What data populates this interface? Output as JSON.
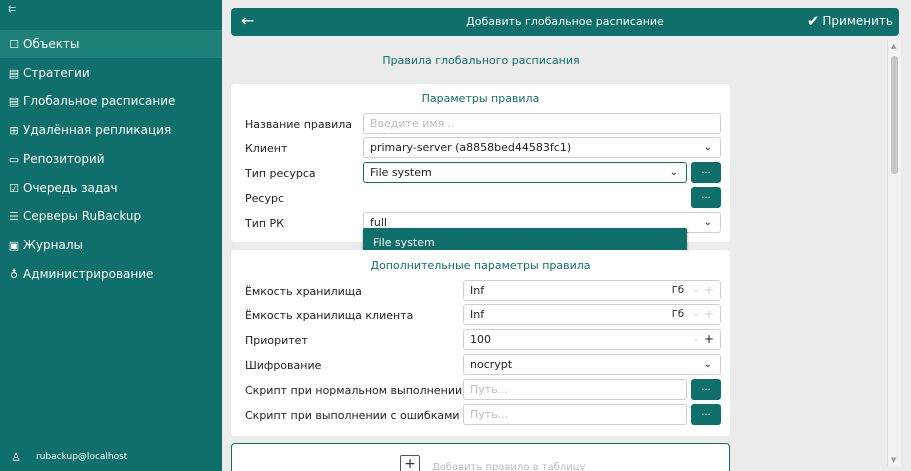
{
  "sidebar": {
    "collapse_icon": "⇇",
    "items": [
      {
        "icon": "☐",
        "label": "Объекты"
      },
      {
        "icon": "▤",
        "label": "Стратегии"
      },
      {
        "icon": "▤",
        "label": "Глобальное расписание"
      },
      {
        "icon": "⊞",
        "label": "Удалённая репликация"
      },
      {
        "icon": "▭",
        "label": "Репозиторий"
      },
      {
        "icon": "☑",
        "label": "Очередь задач"
      },
      {
        "icon": "☰",
        "label": "Серверы RuBackup"
      },
      {
        "icon": "▣",
        "label": "Журналы"
      },
      {
        "icon": "♁",
        "label": "Администрирование"
      }
    ],
    "user": {
      "icon": "♙",
      "label": "rubackup@localhost"
    }
  },
  "header": {
    "back_icon": "←",
    "title": "Добавить глобальное расписание",
    "apply_icon": "✔",
    "apply_label": "Применить"
  },
  "main": {
    "section_title": "Правила глобального расписания",
    "params": {
      "title": "Параметры правила",
      "rule_name_label": "Название правила",
      "rule_name_placeholder": "Введите имя ..",
      "client_label": "Клиент",
      "client_value": "primary-server (a8858bed44583fc1)",
      "resource_type_label": "Тип ресурса",
      "resource_type_value": "File system",
      "resource_label": "Ресурс",
      "backup_type_label": "Тип РК",
      "backup_type_value": "full",
      "dots": "...",
      "chevron": "⌄",
      "dropdown_option": "File system"
    },
    "extra": {
      "title": "Дополнительные параметры правила",
      "storage_label": "Ёмкость хранилища",
      "storage_value": "Inf",
      "storage_unit": "Гб",
      "client_storage_label": "Ёмкость хранилища клиента",
      "client_storage_value": "Inf",
      "client_storage_unit": "Гб",
      "priority_label": "Приоритет",
      "priority_value": "100",
      "encryption_label": "Шифрование",
      "encryption_value": "nocrypt",
      "script_ok_label": "Скрипт при нормальном выполнении",
      "script_ok_placeholder": "Путь...",
      "script_err_label": "Скрипт при выполнении с ошибками",
      "script_err_placeholder": "Путь...",
      "minus": "-",
      "plus": "+"
    },
    "add_button": {
      "icon": "+",
      "label": "Добавить правило в таблицу"
    }
  }
}
